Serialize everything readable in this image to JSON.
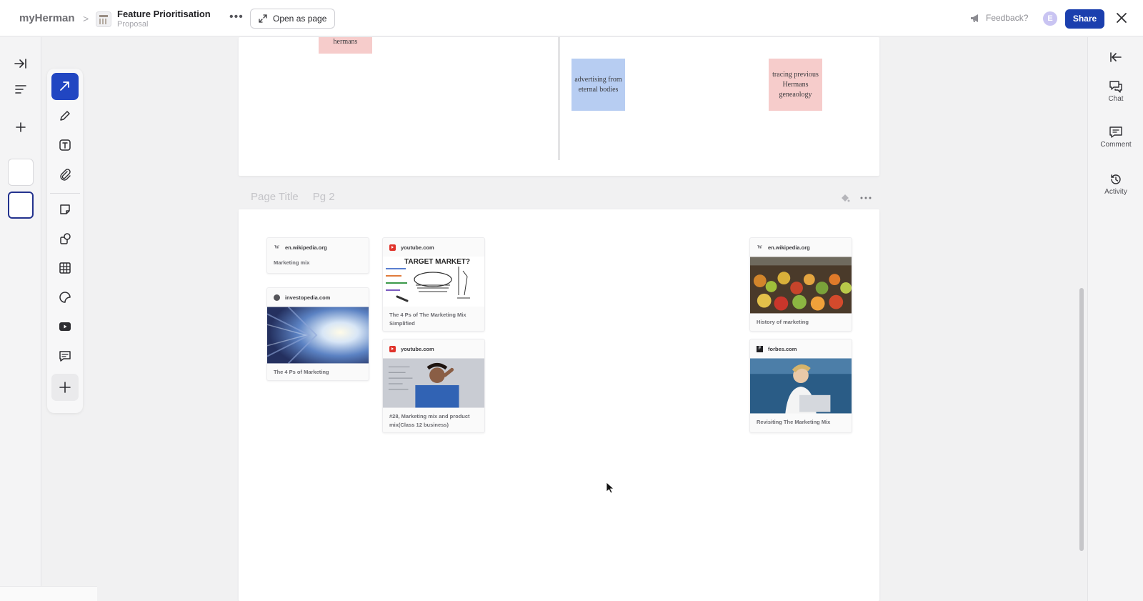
{
  "topbar": {
    "workspace": "myHerman",
    "separator": ">",
    "page_title": "Feature Prioritisation",
    "page_subtitle": "Proposal",
    "more": "•••",
    "open_as_page_label": "Open as page",
    "feedback_label": "Feedback?",
    "avatar_initial": "E",
    "share_label": "Share"
  },
  "right_rail": {
    "items": [
      {
        "label": "Chat"
      },
      {
        "label": "Comment"
      },
      {
        "label": "Activity"
      }
    ]
  },
  "canvas": {
    "stickies": [
      {
        "text": "hermans",
        "color": "#f6cccb"
      },
      {
        "text": "advertising from eternal bodies",
        "color": "#b7cdf2"
      },
      {
        "text": "tracing previous Hermans geneaology",
        "color": "#f6cccb"
      }
    ],
    "section": {
      "title": "Page Title",
      "page_label": "Pg 2"
    },
    "cards": [
      {
        "source": "en.wikipedia.org",
        "caption": "Marketing mix"
      },
      {
        "source": "investopedia.com",
        "caption": "The 4 Ps of Marketing"
      },
      {
        "source": "youtube.com",
        "caption": "The 4 Ps of The Marketing Mix Simplified",
        "image_text": "TARGET MARKET?"
      },
      {
        "source": "youtube.com",
        "caption": "#28, Marketing mix and product mix(Class 12 business)"
      },
      {
        "source": "en.wikipedia.org",
        "caption": "History of marketing"
      },
      {
        "source": "forbes.com",
        "caption": "Revisiting The Marketing Mix"
      }
    ]
  },
  "colors": {
    "accent": "#2146c2",
    "share": "#1b3fae",
    "sticky_pink": "#f6cccb",
    "sticky_blue": "#b7cdf2"
  }
}
